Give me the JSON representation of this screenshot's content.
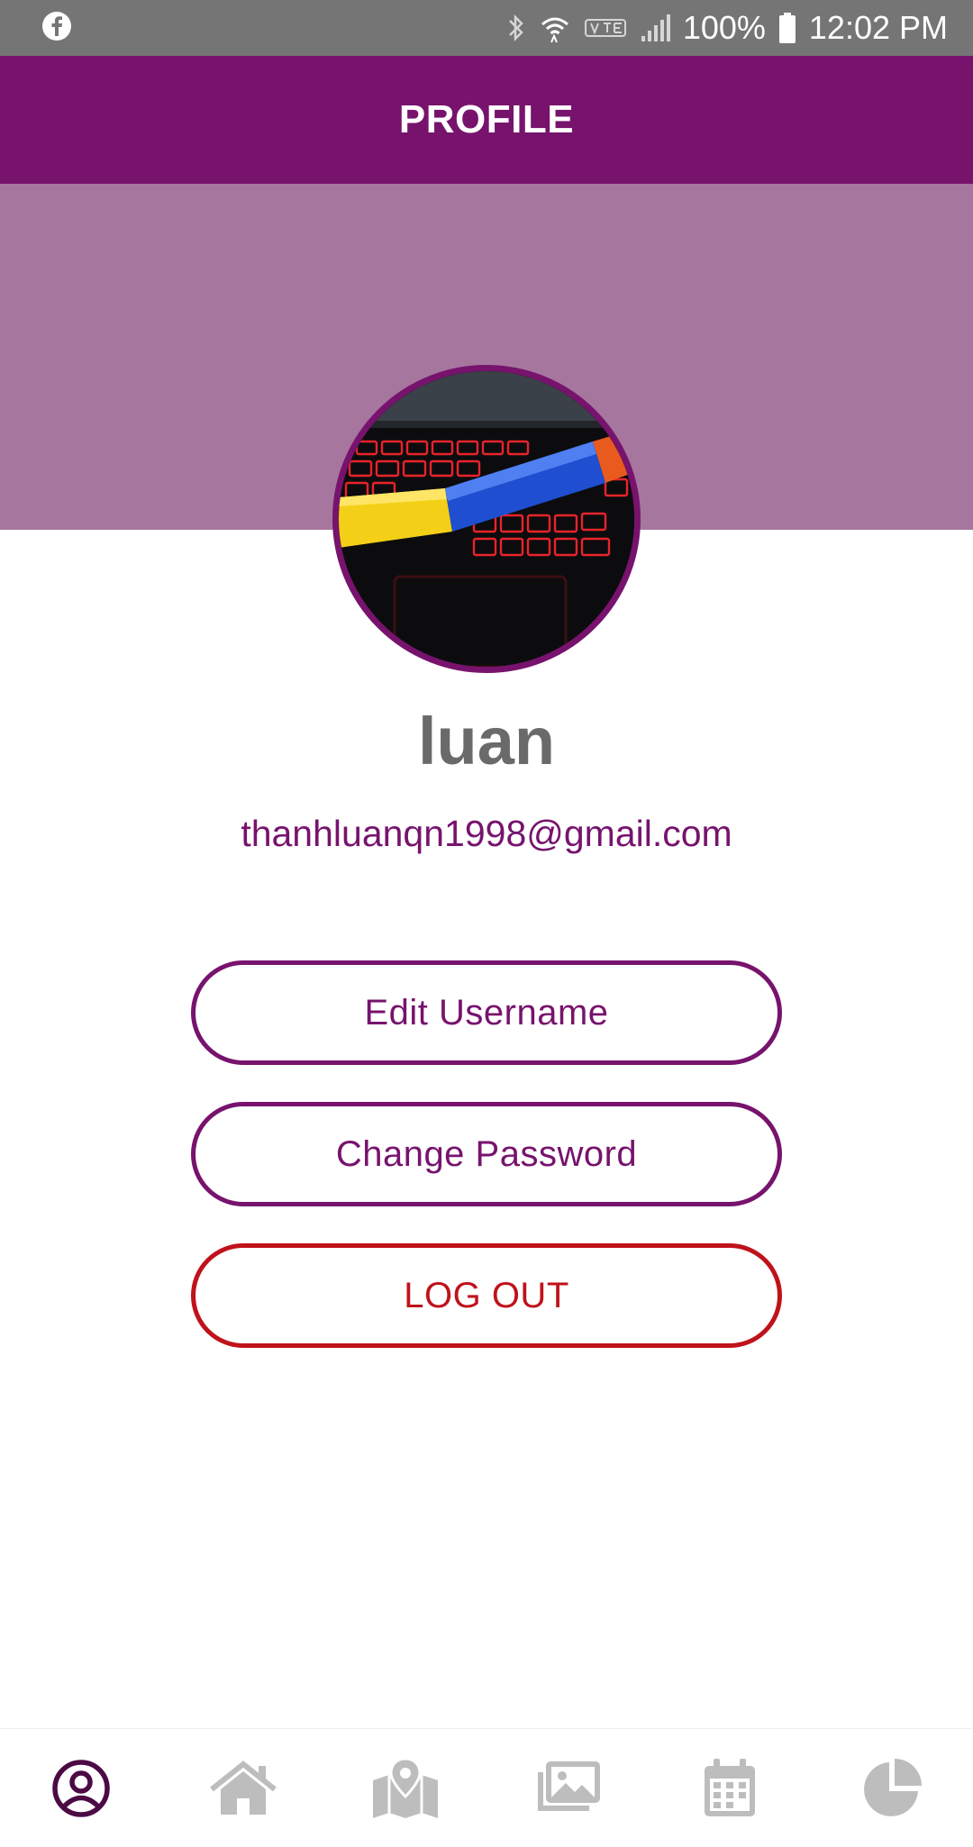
{
  "status_bar": {
    "battery": "100%",
    "time": "12:02 PM",
    "icons": [
      "facebook-icon",
      "bluetooth-icon",
      "wifi-icon",
      "volte-icon",
      "signal-icon",
      "battery-icon"
    ]
  },
  "app_bar": {
    "title": "PROFILE"
  },
  "profile": {
    "username": "luan",
    "email": "thanhluanqn1998@gmail.com"
  },
  "actions": {
    "edit_username": "Edit Username",
    "change_password": "Change Password",
    "logout": "LOG OUT"
  },
  "bottom_nav": {
    "items": [
      "profile-icon",
      "home-icon",
      "map-icon",
      "gallery-icon",
      "calendar-icon",
      "pie-chart-icon"
    ],
    "active": "profile-icon"
  },
  "colors": {
    "primary": "#77136d",
    "header_band": "#a6769f",
    "danger": "#c0121b",
    "status_bar": "#757575",
    "nav_inactive": "#bdbdbd",
    "username": "#6a6a6a"
  }
}
